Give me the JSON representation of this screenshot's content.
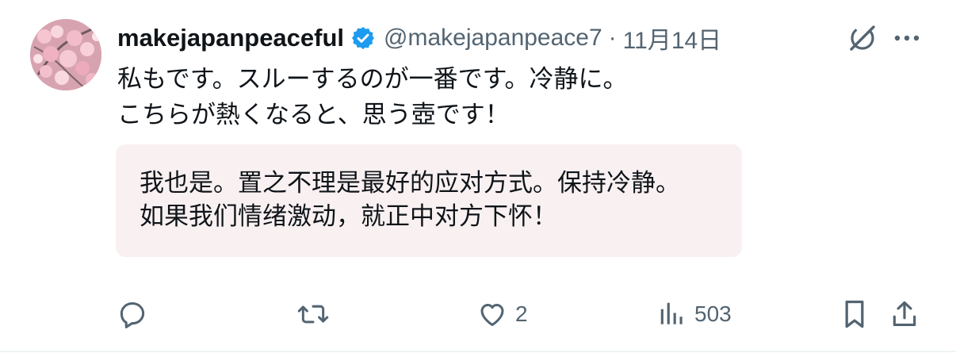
{
  "post": {
    "display_name": "makejapanpeaceful",
    "handle": "@makejapanpeace7",
    "separator": "·",
    "timestamp": "11月14日",
    "text_lines": [
      "私もです。スルーするのが一番です。冷静に。",
      "こちらが熱くなると、思う壺です！"
    ],
    "translation_lines": [
      "我也是。置之不理是最好的应对方式。保持冷静。",
      "如果我们情绪激动，就正中对方下怀！"
    ],
    "verified": true,
    "verified_color": "#1d9bf0"
  },
  "actions": {
    "reply": {
      "icon": "reply-icon",
      "count": ""
    },
    "repost": {
      "icon": "repost-icon",
      "count": ""
    },
    "like": {
      "icon": "heart-icon",
      "count": "2"
    },
    "views": {
      "icon": "views-icon",
      "count": "503"
    },
    "bookmark": {
      "icon": "bookmark-icon"
    },
    "share": {
      "icon": "share-icon"
    }
  },
  "colors": {
    "text": "#0f1419",
    "secondary": "#536471",
    "translation_bg": "#f9f1f1",
    "divider": "#eff3f4"
  }
}
